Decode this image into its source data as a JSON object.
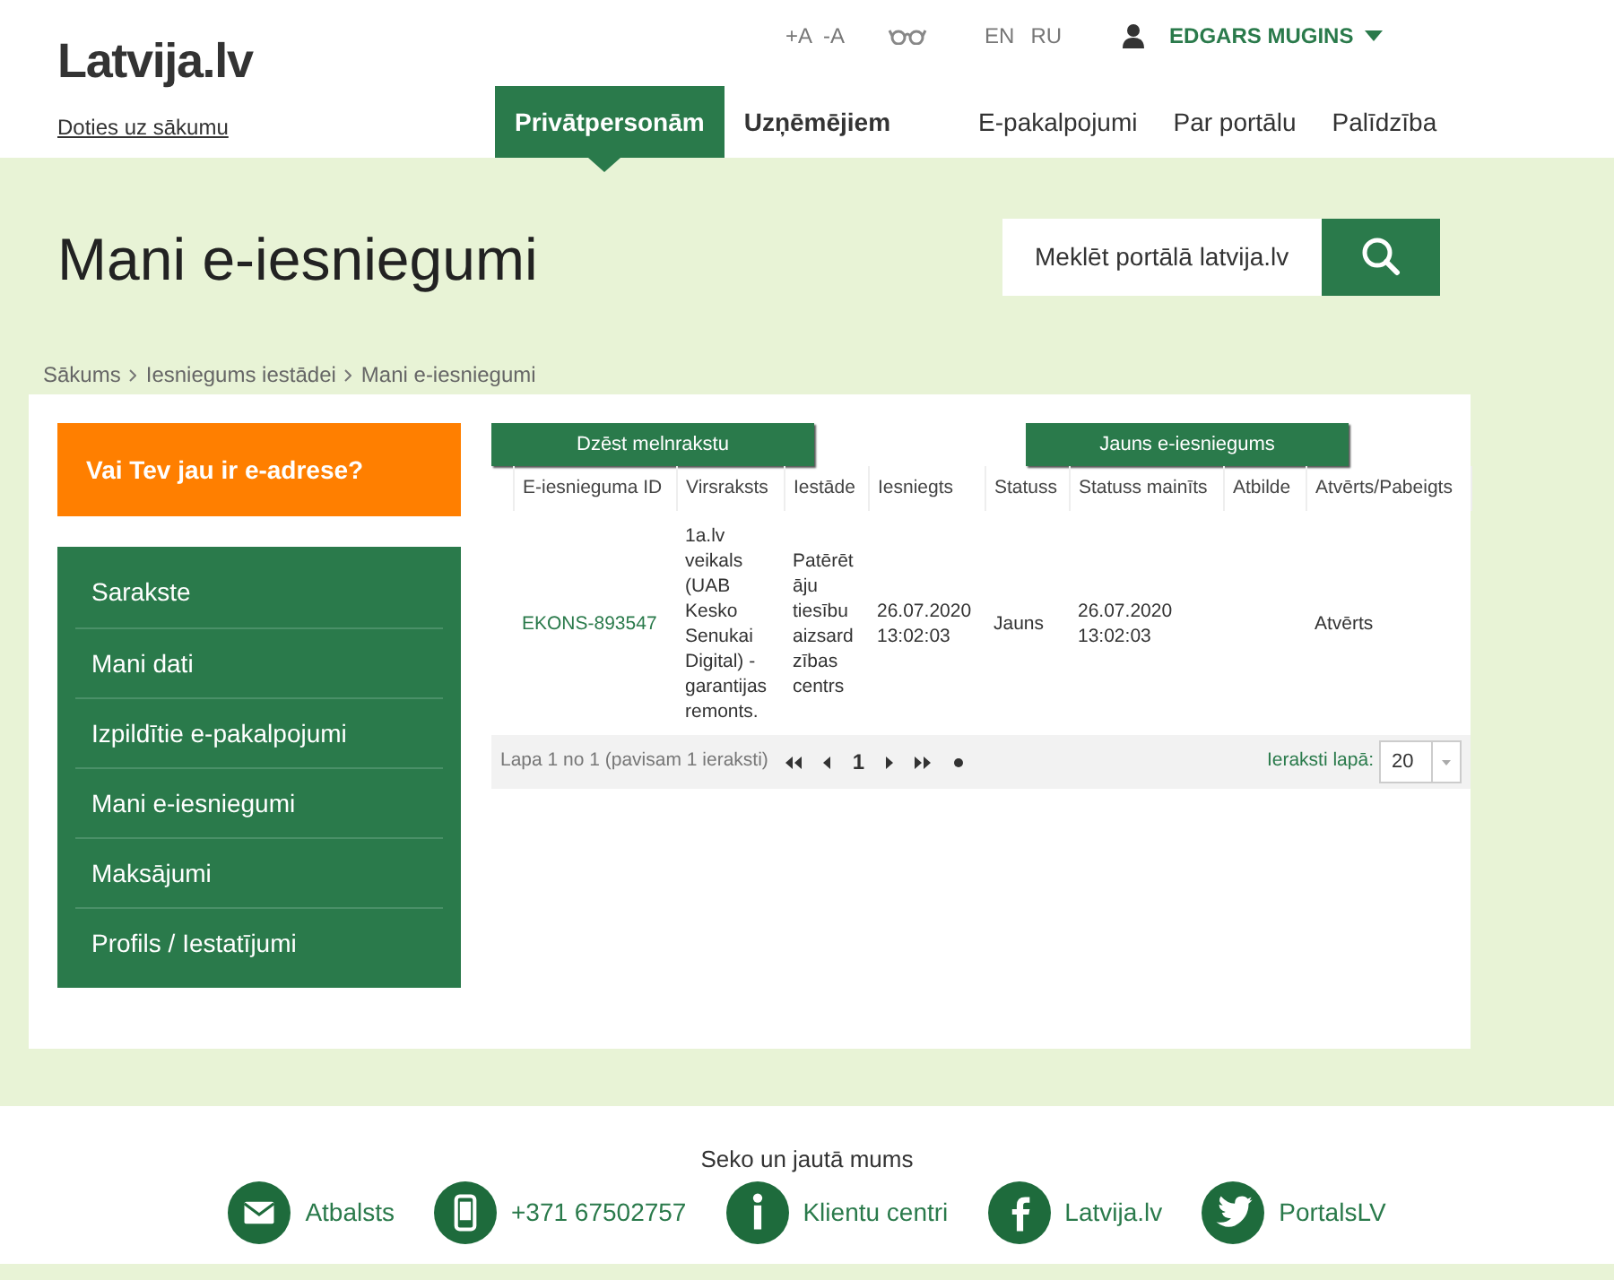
{
  "header": {
    "logo": "Latvija.lv",
    "home_link": "Doties uz sākumu",
    "font_controls": [
      "+A",
      "-A"
    ],
    "languages": [
      "EN",
      "RU"
    ],
    "user": "EDGARS MUGINS"
  },
  "nav": [
    {
      "label": "Privātpersonām",
      "selected": true
    },
    {
      "label": "Uzņēmējiem",
      "selected": false
    }
  ],
  "nav_links": [
    "E-pakalpojumi",
    "Par portālu",
    "Palīdzība"
  ],
  "page_title": "Mani e-iesniegumi",
  "search": {
    "placeholder": "Meklēt portālā latvija.lv"
  },
  "breadcrumbs": [
    "Sākums",
    "Iesniegums iestādei",
    "Mani e-iesniegumi"
  ],
  "eaddress_banner": "Vai Tev jau ir e-adrese?",
  "sidebar": {
    "items": [
      {
        "label": "Sarakste",
        "selected": false
      },
      {
        "label": "Mani dati",
        "selected": false
      },
      {
        "label": "Izpildītie e-pakalpojumi",
        "selected": false
      },
      {
        "label": "Mani e-iesniegumi",
        "selected": false
      },
      {
        "label": "Maksājumi",
        "selected": false
      },
      {
        "label": "Profils / Iestatījumi",
        "selected": false
      }
    ]
  },
  "buttons": [
    "Dzēst melnrakstu",
    "Jauns e-iesniegums"
  ],
  "table": {
    "columns": [
      "E-iesnieguma ID",
      "Virsraksts",
      "Iestāde",
      "Iesniegts",
      "Statuss",
      "Statuss mainīts",
      "Atbilde",
      "Atvērts/Pabeigts"
    ],
    "rows": [
      [
        "EKONS-893547",
        "1a.lv veikals (UAB Kesko Senukai Digital) - garantijas remonts.",
        "Patērētāju tiesību aizsardzības centrs",
        "26.07.2020 13:02:03",
        "Jauns",
        "26.07.2020 13:02:03",
        "",
        "Atvērts"
      ]
    ]
  },
  "pager": {
    "summary": "Lapa 1 no 1 (pavisam 1 ieraksti)",
    "page": "1",
    "per_page_label": "Ieraksti lapā:",
    "per_page": "20"
  },
  "footer": {
    "title": "Seko un jautā mums",
    "links": [
      {
        "kind": "mail",
        "label": "Atbalsts"
      },
      {
        "kind": "phone",
        "label": "+371 67502757"
      },
      {
        "kind": "info",
        "label": "Klientu centri"
      },
      {
        "kind": "facebook",
        "label": "Latvija.lv"
      },
      {
        "kind": "twitter",
        "label": "PortalsLV"
      }
    ]
  }
}
